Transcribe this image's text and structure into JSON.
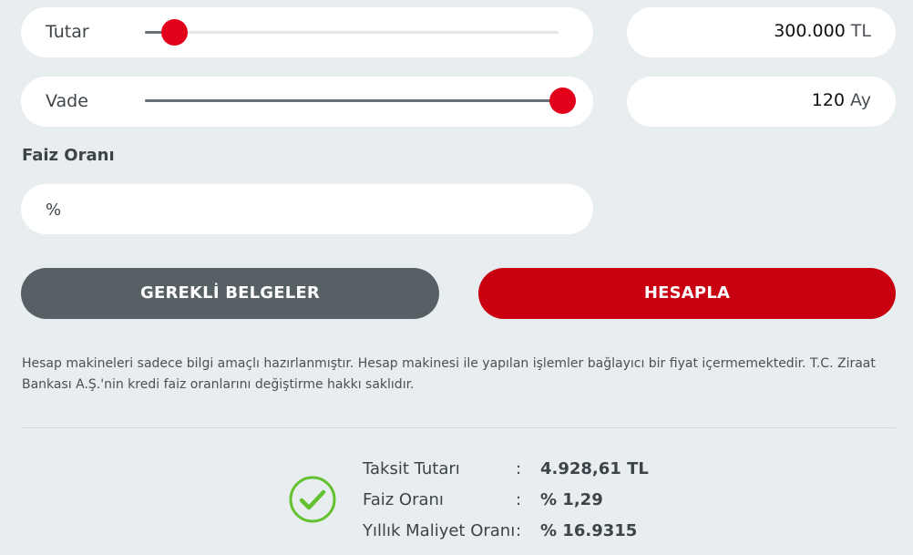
{
  "tutar": {
    "label": "Tutar",
    "slider_fraction": 0.07,
    "value": "300.000",
    "unit": "TL"
  },
  "vade": {
    "label": "Vade",
    "slider_fraction": 1.0,
    "value": "120",
    "unit": "Ay"
  },
  "faiz": {
    "heading": "Faiz Oranı",
    "symbol": "%",
    "value": ""
  },
  "buttons": {
    "documents": "GEREKLİ BELGELER",
    "calculate": "HESAPLA"
  },
  "disclaimer": "Hesap makineleri sadece bilgi amaçlı hazırlanmıştır. Hesap makinesi ile yapılan işlemler bağlayıcı bir fiyat içermemektedir. T.C. Ziraat Bankası A.Ş.'nin kredi faiz oranlarını değiştirme hakkı saklıdır.",
  "results": [
    {
      "label": "Taksit Tutarı",
      "sep": ":",
      "value": "4.928,61 TL"
    },
    {
      "label": "Faiz Oranı",
      "sep": ":",
      "value": "% 1,29"
    },
    {
      "label": "Yıllık Maliyet Oranı",
      "sep": ":",
      "value": "% 16.9315"
    }
  ],
  "icons": {
    "result_status": "check-circle-icon"
  },
  "colors": {
    "brand_red": "#e2001a",
    "button_red": "#c8000f",
    "button_gray": "#566065",
    "success_green": "#63c12f"
  }
}
